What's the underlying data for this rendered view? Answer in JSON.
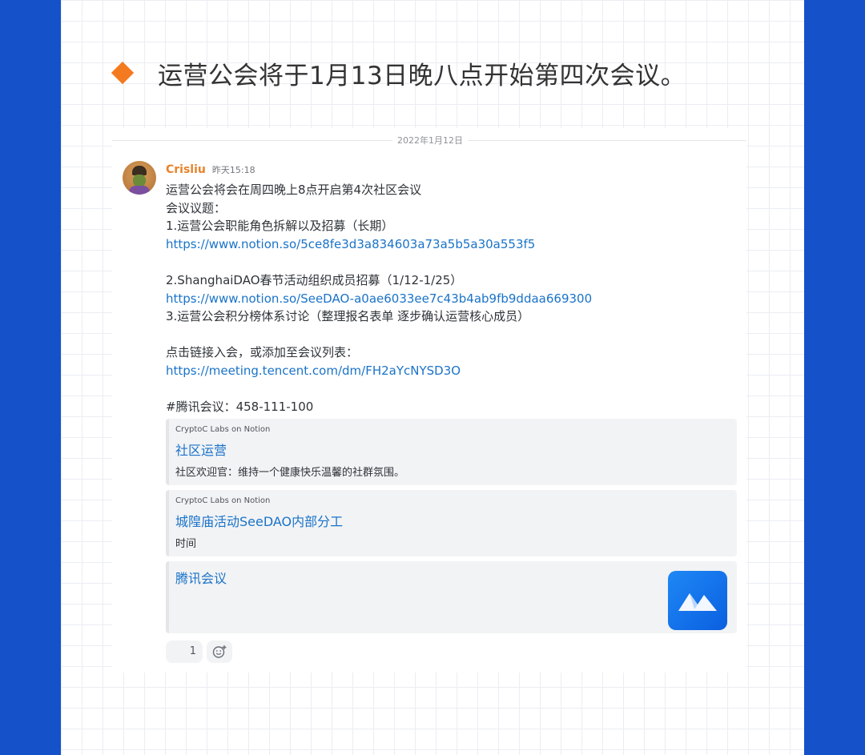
{
  "headline": "运营公会将于1月13日晚八点开始第四次会议。",
  "date_divider": "2022年1月12日",
  "message": {
    "author": "Crisliu",
    "time": "昨天15:18",
    "lines": [
      "运营公会将会在周四晚上8点开启第4次社区会议",
      "会议议题：",
      "1.运营公会职能角色拆解以及招募（长期）",
      "https://www.notion.so/5ce8fe3d3a834603a73a5b5a30a553f5",
      "",
      "2.ShanghaiDAO春节活动组织成员招募（1/12-1/25）",
      "https://www.notion.so/SeeDAO-a0ae6033ee7c43b4ab9fb9ddaa669300",
      "3.运营公会积分榜体系讨论（整理报名表单 逐步确认运营核心成员）",
      "",
      "点击链接入会，或添加至会议列表：",
      "https://meeting.tencent.com/dm/FH2aYcNYSD3O",
      "",
      "#腾讯会议：458-111-100"
    ]
  },
  "embeds": [
    {
      "provider": "CryptoC Labs on Notion",
      "title": "社区运营",
      "description": "社区欢迎官：维持一个健康快乐温馨的社群氛围。"
    },
    {
      "provider": "CryptoC Labs on Notion",
      "title": "城隍庙活动SeeDAO内部分工",
      "description": "时间"
    },
    {
      "title": "腾讯会议"
    }
  ],
  "reaction": {
    "count": "1"
  },
  "colors": {
    "accent": "#f47a20",
    "frame": "#1552c9",
    "link": "#1a73c8",
    "username": "#e8832a"
  }
}
